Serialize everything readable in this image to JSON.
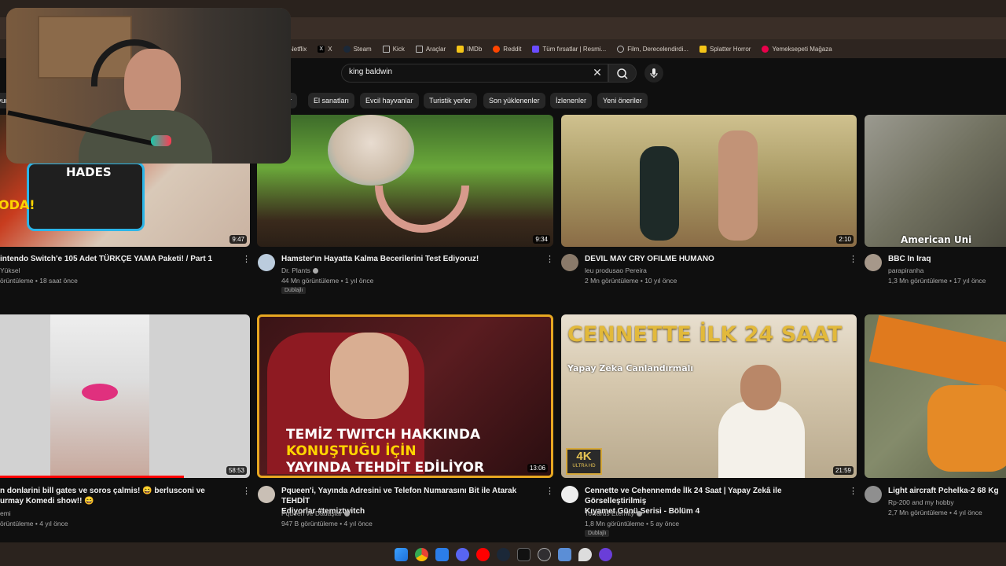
{
  "bookmarks": [
    {
      "label": "Netflix",
      "icon": "netflix-icon",
      "color": "#e50914"
    },
    {
      "label": "X",
      "icon": "x-icon",
      "color": "#000000"
    },
    {
      "label": "Steam",
      "icon": "steam-icon",
      "color": "#1b2838"
    },
    {
      "label": "Kick",
      "icon": "folder-icon",
      "color": "#2e2520"
    },
    {
      "label": "Araçlar",
      "icon": "folder-icon",
      "color": "#2e2520"
    },
    {
      "label": "IMDb",
      "icon": "imdb-icon",
      "color": "#f5c518"
    },
    {
      "label": "Reddit",
      "icon": "reddit-icon",
      "color": "#ff4500"
    },
    {
      "label": "Tüm fırsatlar | Resmi...",
      "icon": "deal-icon",
      "color": "#6a4cff"
    },
    {
      "label": "Film, Derecelendirdi...",
      "icon": "globe-icon",
      "color": "#777777"
    },
    {
      "label": "Splatter Horror",
      "icon": "bookmark-icon",
      "color": "#f5c518"
    },
    {
      "label": "Yemeksepeti Mağaza",
      "icon": "yemeksepeti-icon",
      "color": "#ea004b"
    }
  ],
  "search": {
    "query": "king baldwin"
  },
  "chips": [
    "ar",
    "El sanatları",
    "Evcil hayvanlar",
    "Turistik yerler",
    "Son yüklenenler",
    "İzlenenler",
    "Yeni öneriler"
  ],
  "chip_left": "yur",
  "videos_row1": [
    {
      "title": "intendo Switch'e 105 Adet TÜRKÇE YAMA Paketi! / Part 1",
      "channel": "Yüksel",
      "stats": "örüntüleme • 18 saat önce",
      "duration": "9:47",
      "thumb_text": "ODA!",
      "thumb_text2": "HADES"
    },
    {
      "title": "Hamster'ın Hayatta Kalma Becerilerini Test Ediyoruz!",
      "channel": "Dr. Plants",
      "stats": "44 Mn görüntüleme • 1 yıl önce",
      "duration": "9:34",
      "badge": "Dublajlı"
    },
    {
      "title": "DEVIL MAY CRY OFILME HUMANO",
      "channel": "leu produsao Pereira",
      "stats": "2 Mn görüntüleme • 10 yıl önce",
      "duration": "2:10"
    },
    {
      "title": "BBC In Iraq",
      "channel": "parapiranha",
      "stats": "1,3 Mn görüntüleme • 17 yıl önce",
      "thumb_text": "American Uni"
    }
  ],
  "videos_row2": [
    {
      "title1": "n donlarini bill gates ve soros çalmis! 😄 berlusconi ve",
      "title2": "urmay Komedi show!! 😄",
      "channel": "emi",
      "stats": "örüntüleme • 4 yıl önce",
      "duration": "58:53"
    },
    {
      "title1": "Pqueen'i, Yayında Adresini ve Telefon Numarasını Bit ile Atarak TEHDİT",
      "title2": "Ediyorlar #temiztwitch",
      "channel": "Pqueen ve Dadaşlar",
      "stats": "947 B görüntüleme • 4 yıl önce",
      "duration": "13:06",
      "thumb_line1": "TEMİZ TWITCH HAKKINDA",
      "thumb_line2": "KONUŞTUĞU İÇİN",
      "thumb_line3": "YAYINDA TEHDİT EDİLİYOR"
    },
    {
      "title1": "Cennette ve Cehennemde İlk 24 Saat | Yapay Zekâ ile Görselleştirilmiş",
      "title2": "Kıyamet Günü Serisi - Bölüm 4",
      "channel": "Towards Eternity",
      "stats": "1,8 Mn görüntüleme • 5 ay önce",
      "duration": "21:59",
      "badge": "Dublajlı",
      "thumb_line1": "CENNETTE İLK 24 SAAT",
      "thumb_line2": "Yapay Zeka Canlandırmalı",
      "quality": "4K",
      "quality_sub": "ULTRA HD"
    },
    {
      "title1": "Light aircraft Pchelka-2 68 Kg",
      "channel": "Rp-200 and my hobby",
      "stats": "2,7 Mn görüntüleme • 4 yıl önce"
    }
  ],
  "taskbar": [
    "windows-icon",
    "chrome-icon",
    "mail-icon",
    "discord-icon",
    "youtube-music-icon",
    "steam-icon",
    "epic-icon",
    "obs-icon",
    "notepad-icon",
    "feather-icon",
    "app-icon"
  ],
  "colors": {
    "bg": "#0f0f0f",
    "chip": "#272727",
    "accent_red": "#ff0000"
  }
}
